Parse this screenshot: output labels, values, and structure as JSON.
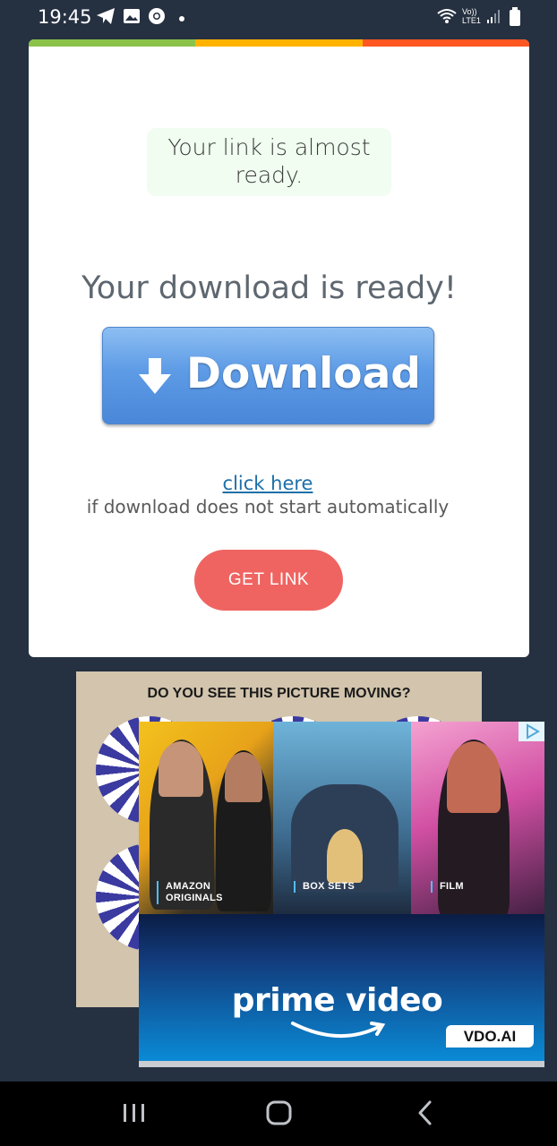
{
  "status_bar": {
    "time": "19:45",
    "icons_left": [
      "telegram-icon",
      "gallery-icon",
      "chrome-icon",
      "dot-icon"
    ],
    "icons_right": [
      "wifi-icon",
      "volte-icon",
      "signal-icon",
      "battery-icon"
    ],
    "volte_label": "Vo))\nLTE1"
  },
  "card": {
    "progress_colors": [
      "#8bc34a",
      "#ffb300",
      "#ff5722"
    ],
    "notice": "Your link is almost ready.",
    "download_title": "Your download is ready!",
    "download_button_label": "Download",
    "click_here_label": "click here",
    "auto_note": "if download does not start automatically",
    "get_link_label": "GET LINK"
  },
  "ads": {
    "back_title": "DO YOU SEE THIS PICTURE MOVING?",
    "front": {
      "labels": [
        "AMAZON\nORIGINALS",
        "BOX SETS",
        "FILM"
      ],
      "brand": "prime video",
      "badge": "VDO.AI"
    }
  },
  "nav_bar": {
    "items": [
      "recents-icon",
      "home-icon",
      "back-icon"
    ]
  }
}
